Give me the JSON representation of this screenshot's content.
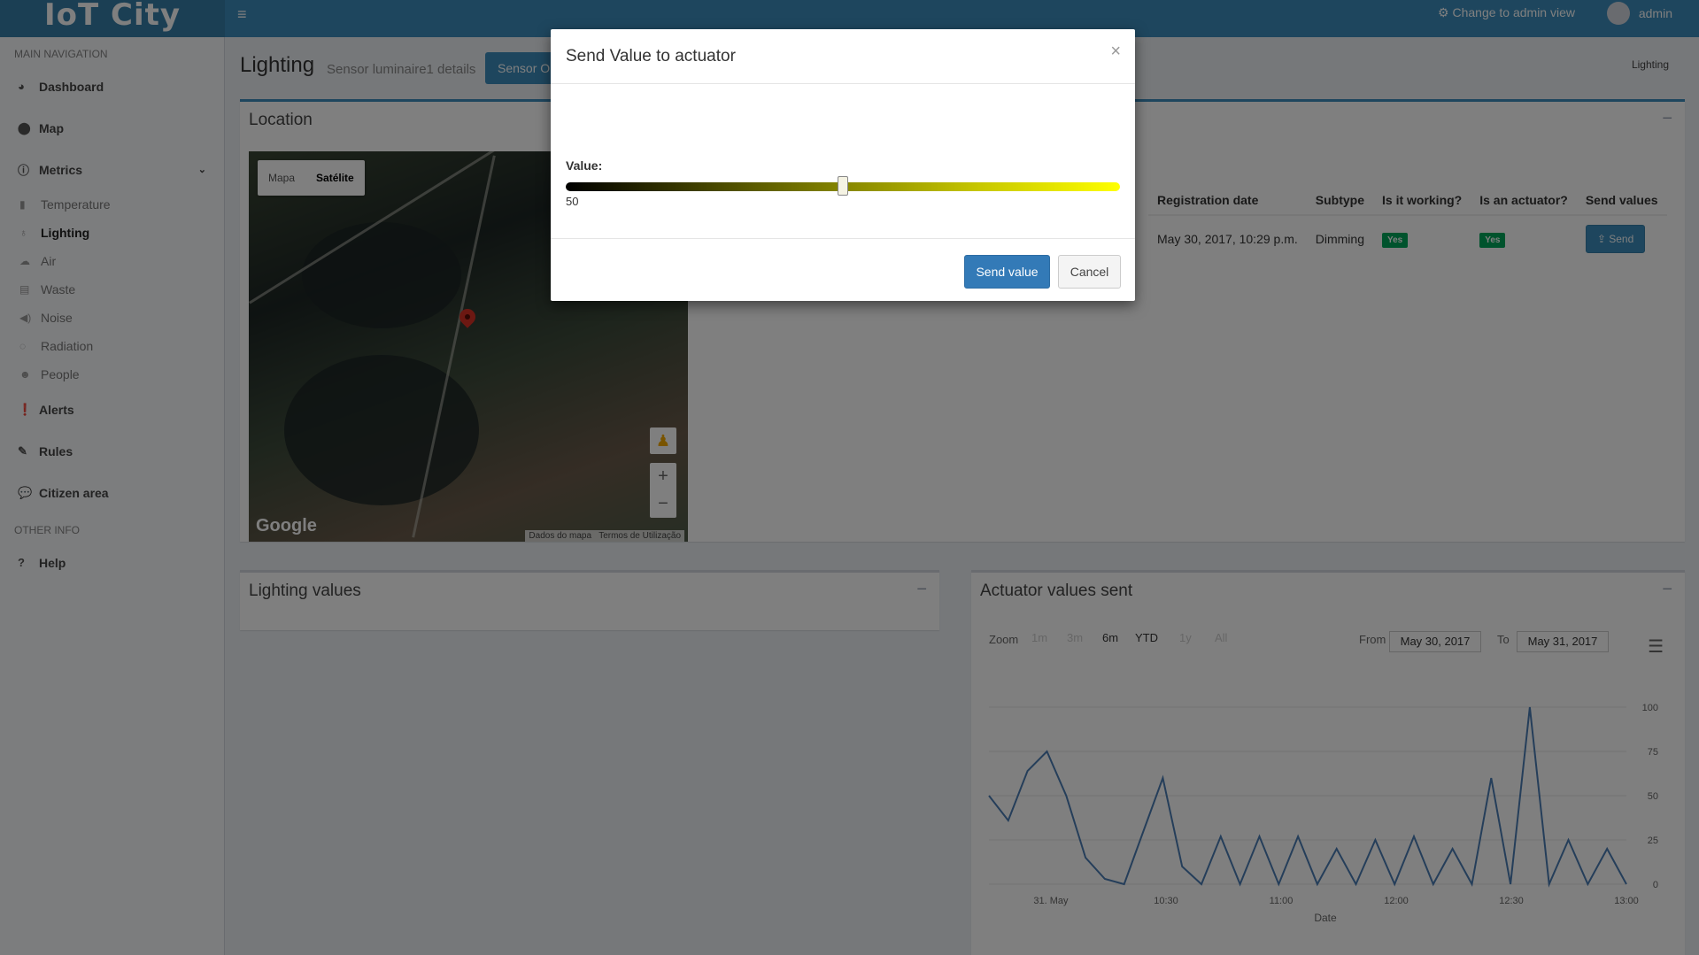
{
  "header": {
    "logo": "IoT City",
    "menu_icon": "hamburger-icon",
    "admin_link": "Change to admin view",
    "username": "admin"
  },
  "sidebar": {
    "main_header": "MAIN NAVIGATION",
    "items": [
      {
        "label": "Dashboard",
        "icon": "dashboard-icon"
      },
      {
        "label": "Map",
        "icon": "map-marker-icon"
      },
      {
        "label": "Metrics",
        "icon": "info-icon"
      }
    ],
    "metrics_sub": [
      {
        "label": "Temperature",
        "icon": "thermometer-icon"
      },
      {
        "label": "Lighting",
        "icon": "lightbulb-icon"
      },
      {
        "label": "Air",
        "icon": "cloud-icon"
      },
      {
        "label": "Waste",
        "icon": "trash-icon"
      },
      {
        "label": "Noise",
        "icon": "volume-icon"
      },
      {
        "label": "Radiation",
        "icon": "radiation-icon"
      },
      {
        "label": "People",
        "icon": "users-icon"
      }
    ],
    "items2": [
      {
        "label": "Alerts",
        "icon": "alert-icon"
      },
      {
        "label": "Rules",
        "icon": "pencil-icon"
      },
      {
        "label": "Citizen area",
        "icon": "comments-icon"
      }
    ],
    "other_header": "OTHER INFO",
    "help": {
      "label": "Help",
      "icon": "question-icon"
    }
  },
  "page": {
    "title": "Lighting",
    "subtitle": "Sensor luminaire1 details",
    "button": "Sensor On",
    "breadcrumb": "Lighting"
  },
  "location_box": {
    "title": "Location",
    "map_type_map": "Mapa",
    "map_type_sat": "Satélite",
    "google": "Google",
    "map_data": "Dados do mapa",
    "terms": "Termos de Utilização"
  },
  "sensor_table": {
    "headers": [
      "Registration date",
      "Subtype",
      "Is it working?",
      "Is an actuator?",
      "Send values"
    ],
    "row": {
      "registration": "May 30, 2017, 10:29 p.m.",
      "subtype": "Dimming",
      "working": "Yes",
      "actuator": "Yes",
      "send": "Send"
    }
  },
  "lighting_box": {
    "title": "Lighting values"
  },
  "actuator_box": {
    "title": "Actuator values sent",
    "zoom_label": "Zoom",
    "range_buttons": [
      "1m",
      "3m",
      "6m",
      "YTD",
      "1y",
      "All"
    ],
    "selected_range": "YTD",
    "from_label": "From",
    "from_value": "May 30, 2017",
    "to_label": "To",
    "to_value": "May 31, 2017"
  },
  "chart_data": {
    "type": "line",
    "xlabel": "Date",
    "ylabel": "",
    "ylim": [
      0,
      100
    ],
    "yticks": [
      0,
      25,
      50,
      75,
      100
    ],
    "xticks": [
      "31. May",
      "10:30",
      "11:00",
      "12:00",
      "12:30",
      "13:00"
    ],
    "series": [
      {
        "color": "#4a7db4",
        "values": [
          50,
          36,
          64,
          75,
          50,
          15,
          3,
          0,
          30,
          60,
          10,
          0,
          27,
          0,
          27,
          0,
          27,
          0,
          20,
          0,
          25,
          0,
          27,
          0,
          20,
          0,
          60,
          0,
          100,
          0,
          25,
          0,
          20,
          0
        ]
      }
    ]
  },
  "modal": {
    "title": "Send Value to actuator",
    "close": "×",
    "value_label": "Value:",
    "value": 50,
    "value_text": "50",
    "slider_min": 0,
    "slider_max": 100,
    "send_button": "Send value",
    "cancel_button": "Cancel"
  }
}
